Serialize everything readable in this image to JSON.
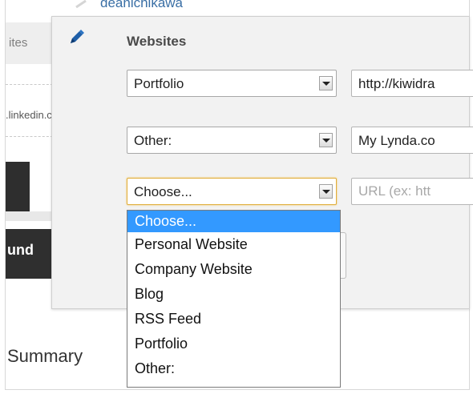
{
  "background": {
    "user_name": "deanichikawa",
    "tab_label": "ites",
    "linkedin_text": ".linkedin.com",
    "dark_button_label": "und",
    "summary_heading": "Summary"
  },
  "panel": {
    "title": "Websites",
    "rows": [
      {
        "type_value": "Portfolio",
        "url_value": "http://kiwidra"
      },
      {
        "type_value": "Other:",
        "url_value": "My Lynda.co"
      },
      {
        "type_value": "Choose...",
        "url_placeholder": "URL (ex: htt"
      }
    ]
  },
  "dropdown": {
    "options": [
      "Choose...",
      "Personal Website",
      "Company Website",
      "Blog",
      "RSS Feed",
      "Portfolio",
      "Other:"
    ],
    "highlighted_index": 0
  },
  "colors": {
    "highlight": "#3399ff",
    "link": "#3a6fa5",
    "focus_border": "#e0ad3a",
    "dark_bar": "#2f2f2f"
  },
  "icons": {
    "edit": "pencil-icon",
    "dropdown_arrow": "chevron-down-icon"
  }
}
